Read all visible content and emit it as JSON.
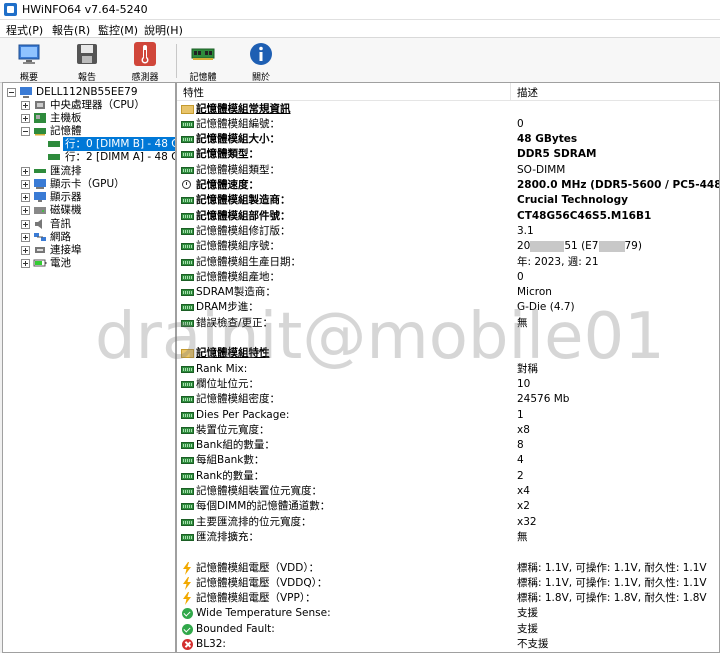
{
  "window": {
    "title": "HWiNFO64 v7.64-5240"
  },
  "menu": [
    "程式(P)",
    "報告(R)",
    "監控(M)",
    "說明(H)"
  ],
  "toolbar": {
    "overview": "概要",
    "report": "報告",
    "sensors": "感測器",
    "memory": "記憶體",
    "about": "關於"
  },
  "tree": {
    "root": "DELL112NB55EE79",
    "cpu": "中央處理器（CPU）",
    "motherboard": "主機板",
    "memory": "記憶體",
    "row0": "行：0 [DIMM B] - 48 G",
    "row1": "行：2 [DIMM A] - 48 G",
    "bus": "匯流排",
    "gpu": "顯示卡（GPU）",
    "monitor": "顯示器",
    "drives": "磁碟機",
    "audio": "音訊",
    "network": "網路",
    "ports": "連接埠",
    "battery": "電池"
  },
  "headers": {
    "feature": "特性",
    "description": "描述"
  },
  "rows": [
    {
      "label": "記憶體模組常規資訊",
      "value": ""
    },
    {
      "label": "記憶體模組編號：",
      "value": "0"
    },
    {
      "label": "記憶體模組大小：",
      "value": "48 GBytes"
    },
    {
      "label": "記憶體類型：",
      "value": "DDR5 SDRAM"
    },
    {
      "label": "記憶體模組類型：",
      "value": "SO-DIMM"
    },
    {
      "label": "記憶體速度：",
      "value": "2800.0 MHz (DDR5-5600 / PC5-44800)"
    },
    {
      "label": "記憶體模組製造商：",
      "value": "Crucial Technology"
    },
    {
      "label": "記憶體模組部件號：",
      "value": "CT48G56C46S5.M16B1"
    },
    {
      "label": "記憶體模組修訂版：",
      "value": "3.1"
    },
    {
      "label": "記憶體模組序號：",
      "value_pre": "20",
      "value_mid": "51 (E7",
      "value_post": "79)"
    },
    {
      "label": "記憶體模組生產日期：",
      "value": "年: 2023, 週: 21"
    },
    {
      "label": "記憶體模組產地：",
      "value": "0"
    },
    {
      "label": "SDRAM製造商：",
      "value": "Micron"
    },
    {
      "label": "DRAM步進：",
      "value": "G-Die (4.7)"
    },
    {
      "label": "錯誤檢查/更正：",
      "value": "無"
    },
    {
      "label": "記憶體模組特性",
      "value": ""
    },
    {
      "label": "Rank Mix:",
      "value": "對稱"
    },
    {
      "label": "欄位址位元：",
      "value": "10"
    },
    {
      "label": "記憶體模組密度：",
      "value": "24576 Mb"
    },
    {
      "label": "Dies Per Package:",
      "value": "1"
    },
    {
      "label": "裝置位元寬度：",
      "value": "x8"
    },
    {
      "label": "Bank組的數量：",
      "value": "8"
    },
    {
      "label": "每組Bank數：",
      "value": "4"
    },
    {
      "label": "Rank的數量：",
      "value": "2"
    },
    {
      "label": "記憶體模組裝置位元寬度：",
      "value": "x4"
    },
    {
      "label": "每個DIMM的記憶體通道數：",
      "value": "x2"
    },
    {
      "label": "主要匯流排的位元寬度：",
      "value": "x32"
    },
    {
      "label": "匯流排擴充：",
      "value": "無"
    },
    {
      "label": "記憶體模組電壓（VDD）：",
      "value": "標稱: 1.1V, 可操作: 1.1V, 耐久性: 1.1V"
    },
    {
      "label": "記憶體模組電壓（VDDQ）：",
      "value": "標稱: 1.1V, 可操作: 1.1V, 耐久性: 1.1V"
    },
    {
      "label": "記憶體模組電壓（VPP）：",
      "value": "標稱: 1.8V, 可操作: 1.8V, 耐久性: 1.8V"
    },
    {
      "label": "Wide Temperature Sense:",
      "value": "支援"
    },
    {
      "label": "Bounded Fault:",
      "value": "支援"
    },
    {
      "label": "BL32:",
      "value": "不支援"
    }
  ],
  "watermark": "drainit@mobile01"
}
